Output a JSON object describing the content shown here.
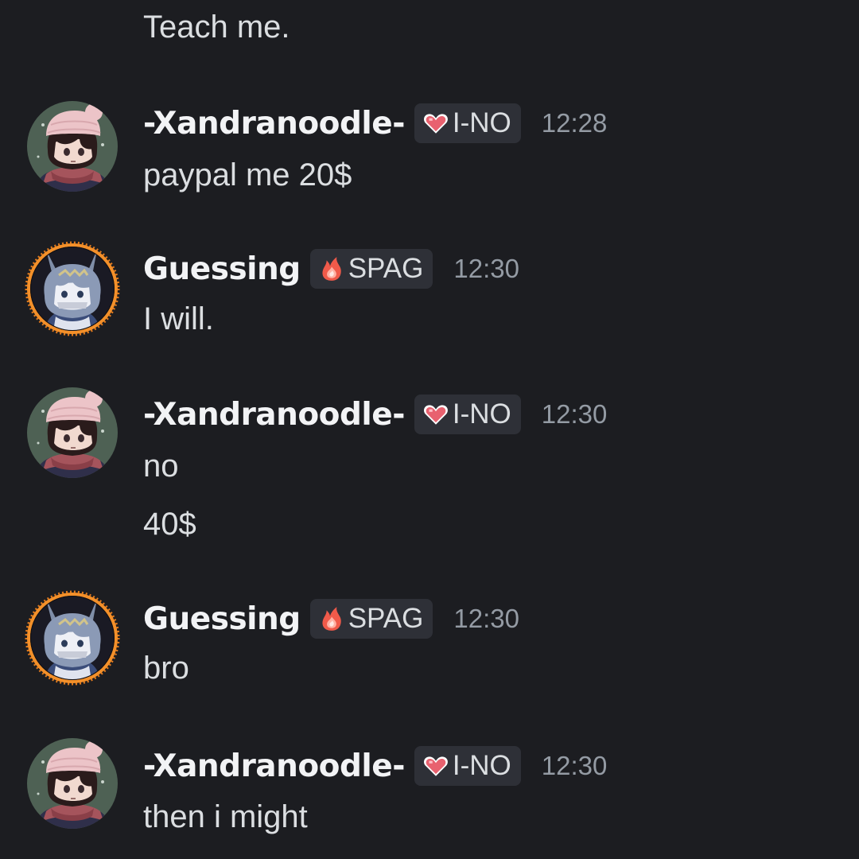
{
  "messages": [
    {
      "content": [
        "Teach me."
      ]
    },
    {
      "author": "-Xandranoodle-",
      "tag": {
        "icon": "heart-icon",
        "label": "I-NO"
      },
      "timestamp": "12:28",
      "content": [
        "paypal me 20$"
      ]
    },
    {
      "author": "Guessing",
      "tag": {
        "icon": "flame-icon",
        "label": "SPAG"
      },
      "timestamp": "12:30",
      "content": [
        "I will."
      ]
    },
    {
      "author": "-Xandranoodle-",
      "tag": {
        "icon": "heart-icon",
        "label": "I-NO"
      },
      "timestamp": "12:30",
      "content": [
        "no",
        "40$"
      ]
    },
    {
      "author": "Guessing",
      "tag": {
        "icon": "flame-icon",
        "label": "SPAG"
      },
      "timestamp": "12:30",
      "content": [
        "bro"
      ]
    },
    {
      "author": "-Xandranoodle-",
      "tag": {
        "icon": "heart-icon",
        "label": "I-NO"
      },
      "timestamp": "12:30",
      "content": [
        "then i might"
      ]
    }
  ],
  "colors": {
    "background": "#1c1d21",
    "username": "#f2f3f5",
    "message_text": "#dbdee1",
    "timestamp": "#949ba4",
    "tag_background": "#2e3037",
    "heart": "#e8616f",
    "flame": "#f05a4a"
  }
}
